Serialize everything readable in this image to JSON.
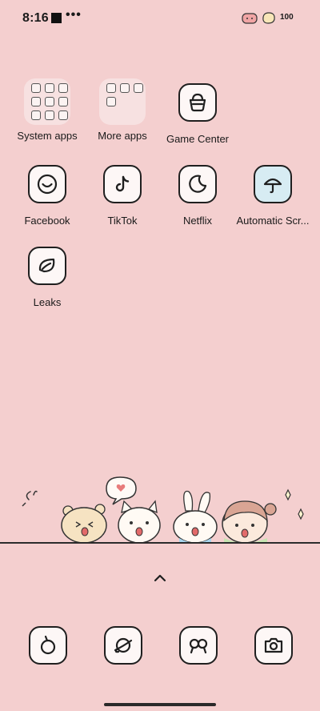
{
  "status_bar": {
    "time": "8:16",
    "overflow": "•••",
    "battery": "100"
  },
  "apps": [
    {
      "label": "System apps",
      "icon": "folder-icon"
    },
    {
      "label": "More apps",
      "icon": "folder-icon"
    },
    {
      "label": "Game Center",
      "icon": "basket-icon"
    },
    {
      "label": "Facebook",
      "icon": "smile-circle-icon"
    },
    {
      "label": "TikTok",
      "icon": "tiktok-note-icon"
    },
    {
      "label": "Netflix",
      "icon": "moon-icon"
    },
    {
      "label": "Automatic Scr...",
      "icon": "umbrella-icon"
    },
    {
      "label": "Leaks",
      "icon": "leaf-icon"
    }
  ],
  "dock": [
    {
      "icon": "phone-icon"
    },
    {
      "icon": "planet-browser-icon"
    },
    {
      "icon": "chat-bubbles-icon"
    },
    {
      "icon": "camera-icon"
    }
  ],
  "colors": {
    "wallpaper": "#f4cfcf",
    "tile": "#fdf7f6",
    "umbrella_tile": "#d7ecf3",
    "outline": "#1f1f1f"
  }
}
